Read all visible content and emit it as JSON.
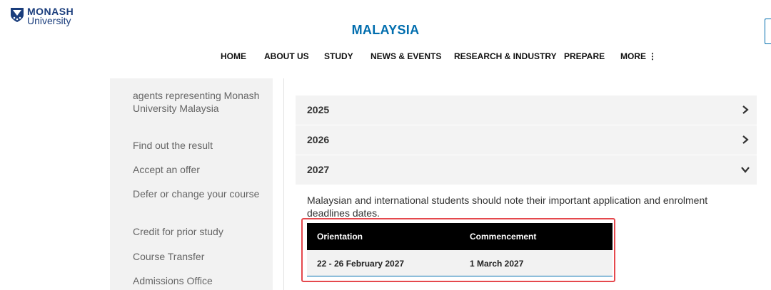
{
  "header": {
    "logo_line1": "MONASH",
    "logo_line2": "University",
    "site_title": "MALAYSIA",
    "nav": [
      "HOME",
      "ABOUT US",
      "STUDY",
      "NEWS & EVENTS",
      "RESEARCH & INDUSTRY",
      "PREPARE",
      "MORE"
    ]
  },
  "sidebar": {
    "items": [
      "agents representing Monash University Malaysia",
      "Find out the result",
      "Accept an offer",
      "Defer or change your course",
      "Credit for prior study",
      "Course Transfer",
      "Admissions Office"
    ]
  },
  "accordion": {
    "items": [
      {
        "label": "2025",
        "state": "collapsed"
      },
      {
        "label": "2026",
        "state": "collapsed"
      },
      {
        "label": "2027",
        "state": "expanded"
      }
    ],
    "expanded_text": "Malaysian and international students should note their important application and enrolment deadlines dates."
  },
  "table": {
    "headers": [
      "Orientation",
      "Commencement"
    ],
    "rows": [
      [
        "22 - 26 February 2027",
        "1 March 2027"
      ]
    ]
  },
  "colors": {
    "brand_blue": "#006dae",
    "highlight_red": "#e5484d",
    "table_header": "#000000"
  }
}
